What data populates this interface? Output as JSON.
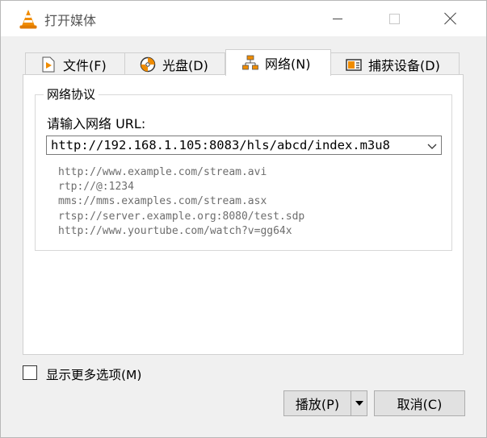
{
  "window": {
    "title": "打开媒体"
  },
  "tabs": [
    {
      "label": "文件(F)",
      "icon": "file-play-icon",
      "active": false
    },
    {
      "label": "光盘(D)",
      "icon": "disc-icon",
      "active": false
    },
    {
      "label": "网络(N)",
      "icon": "network-icon",
      "active": true
    },
    {
      "label": "捕获设备(D)",
      "icon": "capture-device-icon",
      "active": false
    }
  ],
  "network": {
    "group_title": "网络协议",
    "url_label": "请输入网络 URL:",
    "url_value": "http://192.168.1.105:8083/hls/abcd/index.m3u8",
    "examples": [
      "http://www.example.com/stream.avi",
      "rtp://@:1234",
      "mms://mms.examples.com/stream.asx",
      "rtsp://server.example.org:8080/test.sdp",
      "http://www.yourtube.com/watch?v=gg64x"
    ]
  },
  "options": {
    "show_more_label": "显示更多选项(M)",
    "show_more_checked": false
  },
  "buttons": {
    "play_label": "播放(P)",
    "cancel_label": "取消(C)"
  },
  "colors": {
    "accent_orange": "#f08c00",
    "border": "#adadad",
    "button_face": "#e1e1e1"
  }
}
